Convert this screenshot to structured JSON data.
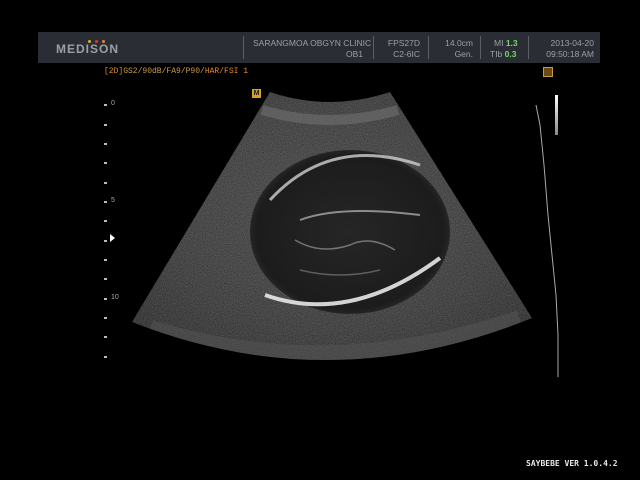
{
  "header": {
    "brand": "MEDISON",
    "clinic": "SARANGMOA OBGYN CLINIC",
    "preset": "OB1",
    "fps": "FPS27D",
    "probe": "C2-6IC",
    "depth": "14.0cm",
    "mode": "Gen.",
    "mi_label": "MI",
    "mi_value": "1.3",
    "tib_label": "TIb",
    "tib_value": "0.3",
    "date": "2013-04-20",
    "time": "09:50:18 AM",
    "logo_dot_colors": [
      "#e0b020",
      "#d04030",
      "#e08a2a"
    ]
  },
  "params": {
    "mode_tag": "[2D]",
    "settings": "GS2/90dB/FA9/P90/",
    "har_fsi": "HAR/FSI 1"
  },
  "markers": {
    "orientation": "M"
  },
  "depth_scale": {
    "labels": [
      "0",
      "5",
      "10"
    ]
  },
  "footer": {
    "version": "SAYBEBE VER 1.0.4.2"
  }
}
